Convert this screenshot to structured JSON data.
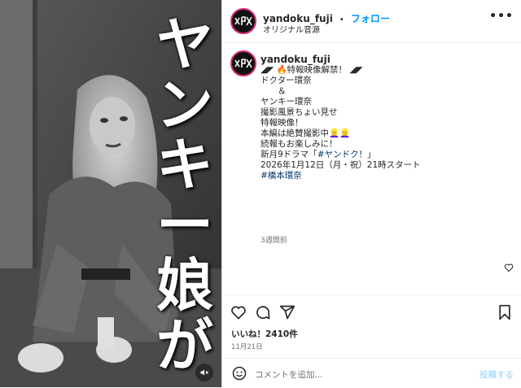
{
  "media": {
    "title_chars": [
      "ヤ",
      "ン",
      "キ",
      "ー",
      "娘",
      "が"
    ],
    "mute_icon": "speaker-muted-icon"
  },
  "header": {
    "username": "yandoku_fuji",
    "separator": "•",
    "follow_label": "フォロー",
    "audio_label": "オリジナル音源",
    "more_icon": "more-horizontal-icon",
    "more_label": "•••"
  },
  "caption": {
    "username": "yandoku_fuji",
    "lines": [
      "◢◤ 🔥特報映像解禁！ ◢◤",
      "",
      "ドクター環奈",
      "　　＆",
      "ヤンキー環奈",
      "",
      "撮影風景ちょい見せ",
      "特報映像！",
      "",
      "本編は絶賛撮影中👱‍♀️👱‍♀️",
      "続報もお楽しみに！",
      ""
    ],
    "drama_line_prefix": "新月9ドラマ「",
    "drama_hashtag": "#ヤンドク",
    "drama_line_suffix": "！」",
    "date_line": "2026年1月12日（月・祝）21時スタート",
    "person_hashtag": "#橋本環奈",
    "time_ago": "3週間前"
  },
  "actions": {
    "like_icon": "heart-icon",
    "comment_icon": "comment-icon",
    "share_icon": "share-icon",
    "save_icon": "bookmark-icon"
  },
  "likes_text": "いいね！2410件",
  "post_date": "11月21日",
  "comment": {
    "emoji_icon": "emoji-icon",
    "placeholder": "コメントを追加...",
    "post_label": "投稿する"
  },
  "colors": {
    "accent_blue": "#0095f6",
    "hashtag": "#00376b",
    "muted": "#737373"
  }
}
